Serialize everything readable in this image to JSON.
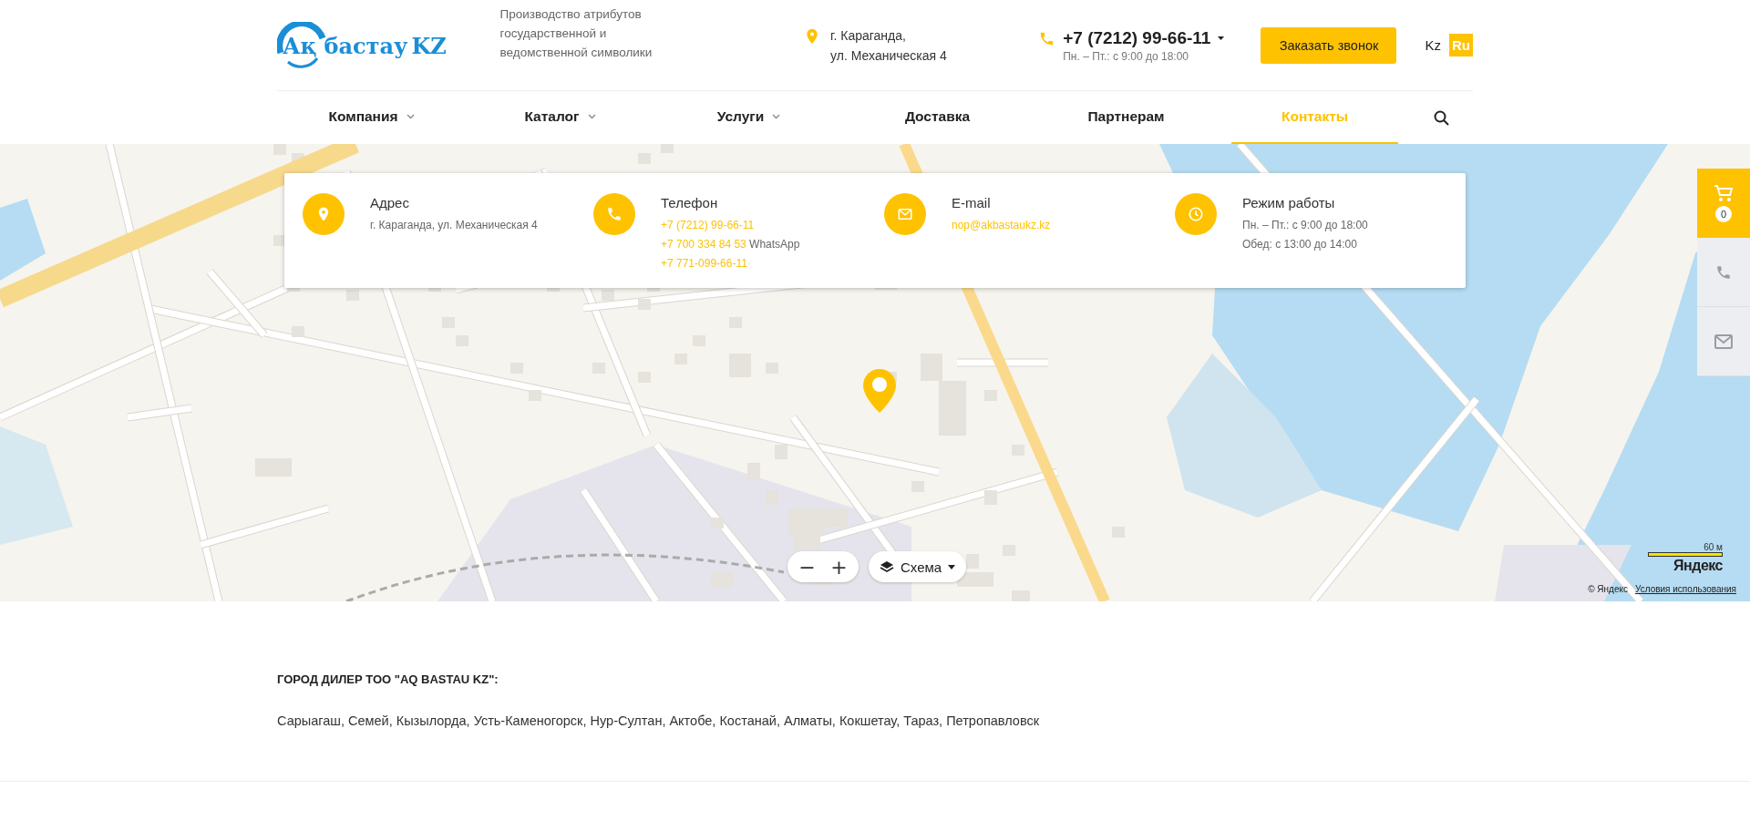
{
  "header": {
    "logo": {
      "prefix": "Ақ",
      "name": "бастау",
      "suffix": "KZ"
    },
    "tagline": "Производство атрибутов государственной и ведомственной символики",
    "address": {
      "lines": [
        "г. Караганда,",
        "ул. Механическая 4"
      ]
    },
    "phone": {
      "number": "+7 (7212) 99-66-11",
      "hours": "Пн. – Пт.: с 9:00 до 18:00"
    },
    "callback_button": "Заказать звонок",
    "languages": [
      {
        "label": "Kz",
        "selected": false
      },
      {
        "label": "Ru",
        "selected": true
      }
    ]
  },
  "nav": {
    "items": [
      {
        "label": "Компания",
        "dropdown": true,
        "selected": false
      },
      {
        "label": "Каталог",
        "dropdown": true,
        "selected": false
      },
      {
        "label": "Услуги",
        "dropdown": true,
        "selected": false
      },
      {
        "label": "Доставка",
        "dropdown": false,
        "selected": false
      },
      {
        "label": "Партнерам",
        "dropdown": false,
        "selected": false
      },
      {
        "label": "Контакты",
        "dropdown": false,
        "selected": true
      }
    ]
  },
  "contacts": {
    "items": [
      {
        "kind": "address",
        "title": "Адрес",
        "lines": [
          {
            "text": "г. Караганда, ул. Механическая 4",
            "link": false
          }
        ]
      },
      {
        "kind": "phone",
        "title": "Телефон",
        "lines": [
          {
            "text": "+7 (7212) 99-66-11",
            "link": true
          },
          {
            "text": "+7 700 334 84 53",
            "link": true,
            "note": "WhatsApp"
          },
          {
            "text": "+7 771-099-66-11",
            "link": true
          }
        ]
      },
      {
        "kind": "email",
        "title": "E-mail",
        "lines": [
          {
            "text": "nop@akbastaukz.kz",
            "link": true
          }
        ]
      },
      {
        "kind": "hours",
        "title": "Режим работы",
        "lines": [
          {
            "text": "Пн. – Пт.: с 9:00 до 18:00",
            "link": false
          },
          {
            "text": "Обед: с 13:00 до 14:00",
            "link": false
          }
        ]
      }
    ]
  },
  "map": {
    "zoom_out": "−",
    "zoom_in": "+",
    "layer": "Схема",
    "scale": "60 м",
    "logo": "Яндекс",
    "copyright": "© Яндекс",
    "terms": "Условия использования"
  },
  "side_panel": {
    "cart_count": "0"
  },
  "dealers": {
    "heading": "ГОРОД ДИЛЕР ТОО \"AQ BASTAU KZ\":",
    "cities": "Сарыагаш, Семей, Кызылорда, Усть-Каменогорск, Нур-Султан, Актобе, Костанай, Алматы, Кокшетау, Тараз, Петропавловск"
  }
}
